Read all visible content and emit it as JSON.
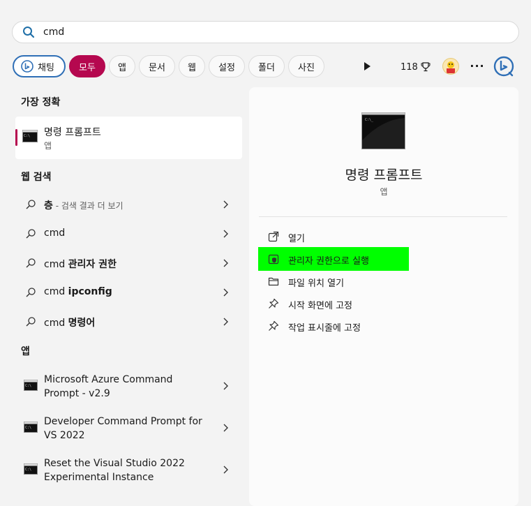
{
  "search": {
    "value": "cmd",
    "icon": "search-icon"
  },
  "filters": [
    {
      "label": "채팅"
    },
    {
      "label": "모두"
    },
    {
      "label": "앱"
    },
    {
      "label": "문서"
    },
    {
      "label": "웹"
    },
    {
      "label": "설정"
    },
    {
      "label": "폴더"
    },
    {
      "label": "사진"
    }
  ],
  "toolbar": {
    "points": "118"
  },
  "colors": {
    "accent": "#b5084f",
    "highlight": "#00ff00",
    "bing": "#2f6fb6"
  },
  "left": {
    "best_title": "가장 정확",
    "best": {
      "name": "명령 프롬프트",
      "type": "앱"
    },
    "web_title": "웹 검색",
    "web": [
      {
        "pre": "",
        "bold": "층",
        "hint": " - 검색 결과 더 보기"
      },
      {
        "pre": "cmd",
        "bold": "",
        "hint": ""
      },
      {
        "pre": "cmd ",
        "bold": "관리자 권한",
        "hint": ""
      },
      {
        "pre": "cmd ",
        "bold": "ipconfig",
        "hint": ""
      },
      {
        "pre": "cmd ",
        "bold": "명령어",
        "hint": ""
      }
    ],
    "apps_title": "앱",
    "apps": [
      {
        "line1": "Microsoft Azure Command",
        "line2": "Prompt - v2.9"
      },
      {
        "line1": "Developer Command Prompt for",
        "line2": "VS 2022"
      },
      {
        "line1": "Reset the Visual Studio 2022",
        "line2": "Experimental Instance"
      }
    ]
  },
  "right": {
    "title": "명령 프롬프트",
    "subtitle": "앱",
    "actions": [
      {
        "label": "열기",
        "icon": "open-external-icon"
      },
      {
        "label": "관리자 권한으로 실행",
        "icon": "shield-icon"
      },
      {
        "label": "파일 위치 열기",
        "icon": "folder-icon"
      },
      {
        "label": "시작 화면에 고정",
        "icon": "pin-icon"
      },
      {
        "label": "작업 표시줄에 고정",
        "icon": "pin-icon"
      }
    ]
  }
}
